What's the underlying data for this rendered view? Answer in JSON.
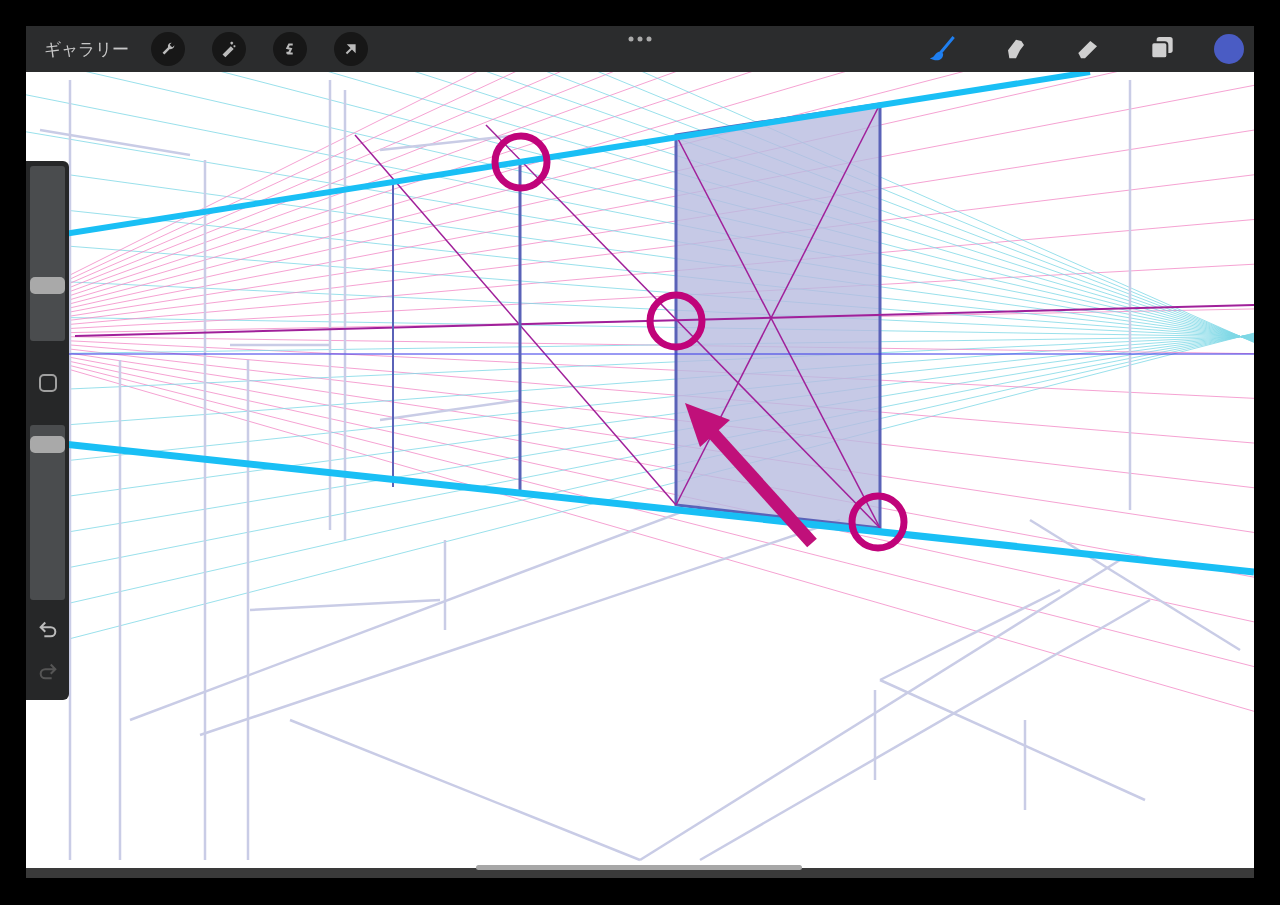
{
  "toolbar": {
    "gallery_label": "ギャラリー",
    "left_tools": [
      {
        "kind": "wrench"
      },
      {
        "kind": "wand"
      },
      {
        "kind": "selection"
      },
      {
        "kind": "transform"
      }
    ],
    "right_tools": [
      {
        "kind": "brush",
        "selected": true
      },
      {
        "kind": "smudge",
        "selected": false
      },
      {
        "kind": "eraser",
        "selected": false
      },
      {
        "kind": "layers",
        "selected": false
      }
    ],
    "color": "#4a5cc4"
  },
  "sidebar": {
    "size_slider": {
      "level": 0.3
    },
    "opacity_slider": {
      "level": 0.93
    },
    "undo": {
      "disabled": false
    },
    "redo": {
      "disabled": true
    }
  }
}
